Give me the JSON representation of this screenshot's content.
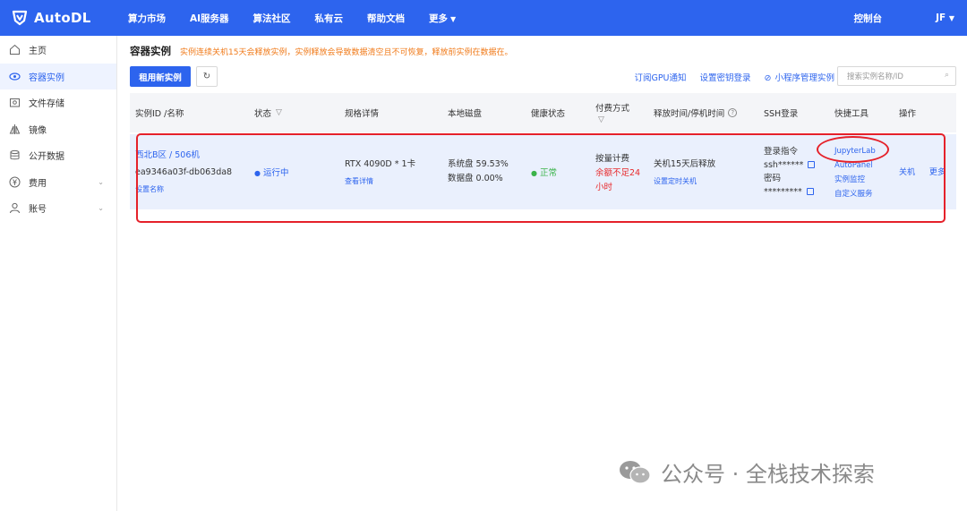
{
  "app": {
    "logo_text": "AutoDL"
  },
  "top_nav": [
    {
      "label": "算力市场"
    },
    {
      "label": "AI服务器"
    },
    {
      "label": "算法社区"
    },
    {
      "label": "私有云"
    },
    {
      "label": "帮助文档"
    },
    {
      "label": "更多"
    }
  ],
  "top_right": {
    "console": "控制台",
    "user": "JF"
  },
  "sidebar": {
    "items": [
      {
        "label": "主页",
        "icon": "home-icon"
      },
      {
        "label": "容器实例",
        "icon": "container-icon",
        "active": true
      },
      {
        "label": "文件存储",
        "icon": "folder-icon"
      },
      {
        "label": "镜像",
        "icon": "image-icon"
      },
      {
        "label": "公开数据",
        "icon": "database-icon"
      },
      {
        "label": "费用",
        "icon": "yen-icon"
      },
      {
        "label": "账号",
        "icon": "user-icon"
      }
    ]
  },
  "page": {
    "title": "容器实例",
    "notice": "实例连续关机15天会释放实例，实例释放会导致数据清空且不可恢复，释放前实例在数据在。"
  },
  "toolbar": {
    "rent_button": "租用新实例",
    "refresh_icon": "refresh-icon",
    "subscribe_gpu": "订阅GPU通知",
    "set_key_login": "设置密钥登录",
    "mini_program": "小程序管理实例",
    "search_placeholder": "搜索实例名称/ID"
  },
  "table": {
    "headers": {
      "id_name": "实例ID /名称",
      "status": "状态",
      "spec": "规格详情",
      "disk": "本地磁盘",
      "health": "健康状态",
      "billing": "付费方式",
      "release": "释放时间/停机时间",
      "ssh": "SSH登录",
      "tools": "快捷工具",
      "ops": "操作"
    },
    "row": {
      "region": "西北B区 / 506机",
      "instance_id": "ea9346a03f-db063da8",
      "set_name": "设置名称",
      "status": "运行中",
      "gpu": "RTX 4090D * 1卡",
      "view_detail": "查看详情",
      "system_disk": "系统盘 59.53%",
      "data_disk": "数据盘 0.00%",
      "health": "正常",
      "billing_type": "按量计费",
      "balance_warning_1": "余额不足24",
      "balance_warning_2": "小时",
      "release_text": "关机15天后释放",
      "set_shutdown": "设置定时关机",
      "login_cmd_label": "登录指令",
      "ssh_masked": "ssh******",
      "password_label": "密码",
      "password_masked": "*********",
      "tool_jupyter": "JupyterLab",
      "tool_autopanel": "AutoPanel",
      "tool_monitor": "实例监控",
      "tool_custom": "自定义服务",
      "op_shutdown": "关机",
      "op_more": "更多"
    }
  },
  "watermark": "公众号 · 全栈技术探索",
  "colors": {
    "brand": "#2d64ee",
    "warning": "#f07a19",
    "danger": "#e8282a",
    "success": "#3bb34a",
    "annotation": "#e5212a"
  }
}
